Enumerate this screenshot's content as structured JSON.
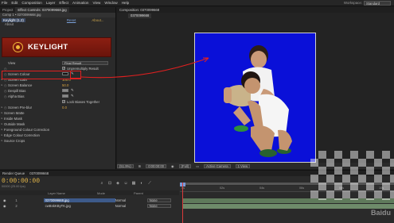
{
  "menu": [
    "File",
    "Edit",
    "Composition",
    "Layer",
    "Effect",
    "Animation",
    "View",
    "Window",
    "Help"
  ],
  "workspace": {
    "label": "Workspace:",
    "value": "Standard"
  },
  "effect_controls": {
    "tab_project": "Project",
    "tab_label": "Effect Controls: 0370099668.jpg",
    "subtitle": "Comp 1 • 0370099668.jpg",
    "effect_name": "Keylight (1.2)",
    "reset": "Reset",
    "about": "About...",
    "about_row": "About",
    "banner_name": "KEYLIGHT",
    "view_label": "View",
    "view_value": "Final Result",
    "unpremultiply": "Unpremultiply Result",
    "screen_colour": "Screen Colour",
    "screen_gain": "Screen Gain",
    "screen_gain_val": "100.0",
    "screen_balance": "Screen Balance",
    "screen_balance_val": "50.0",
    "despill_bias": "Despill Bias",
    "alpha_bias": "Alpha Bias",
    "lock_biases": "Lock Biases Together",
    "screen_prebur": "Screen Pre-blur",
    "screen_prebur_val": "0.0",
    "groups": [
      "Screen Matte",
      "Inside Mask",
      "Outside Mask",
      "Foreground Colour Correction",
      "Edge Colour Correction",
      "Source Crops"
    ]
  },
  "composition": {
    "tab_label": "Composition: 0370099668",
    "sub_tab": "0370099668"
  },
  "comp_toolbar": [
    "(51.9%)",
    "0:00:00:00",
    "(Full)",
    "Active Camera",
    "1 View"
  ],
  "timeline": {
    "tab_render": "Render Queue",
    "tab_comp": "0370099668",
    "timecode": "0:00:00:00",
    "fps": "00000 (25.00 fps)",
    "col_layer_name": "Layer Name",
    "col_mode": "Mode",
    "col_parent": "Parent",
    "layers": [
      {
        "num": "1",
        "name": "0370099668.jpg",
        "mode": "Normal",
        "parent": "None"
      },
      {
        "num": "2",
        "name": "cwBnkKByTK.jpg",
        "mode": "Normal",
        "parent": "None"
      }
    ],
    "ticks": [
      "0s",
      "02s",
      "04s",
      "06s",
      "08s",
      "10s"
    ],
    "watermark": "Baidu"
  }
}
